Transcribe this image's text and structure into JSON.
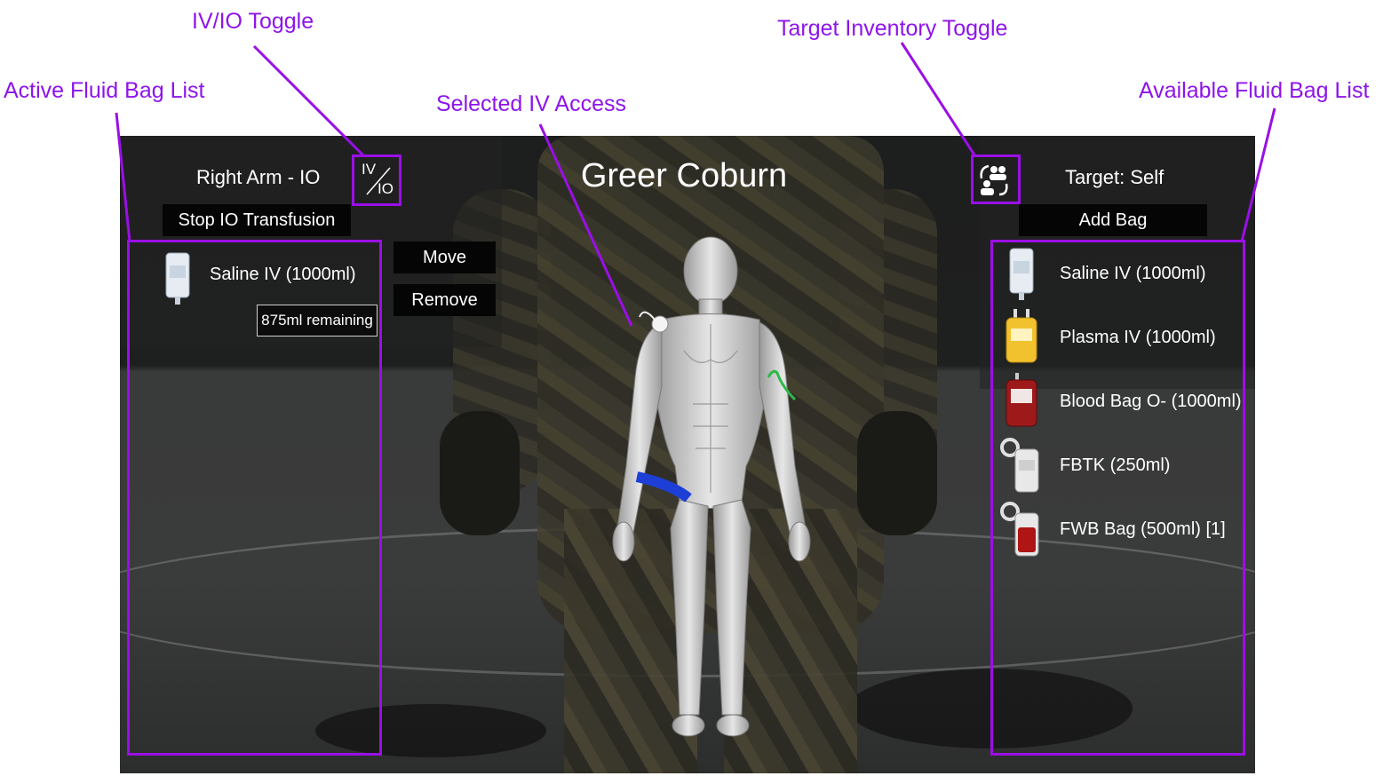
{
  "game": {
    "patient_name": "Greer Coburn",
    "left_panel": {
      "access_site": "Right Arm - IO",
      "stop_button": "Stop IO Transfusion",
      "toggle_top": "IV",
      "toggle_bottom": "IO",
      "active_bags": [
        {
          "label": "Saline IV (1000ml)",
          "remaining": "875ml remaining",
          "icon": "saline-bag-icon"
        }
      ],
      "move_button": "Move",
      "remove_button": "Remove"
    },
    "right_panel": {
      "target": "Target: Self",
      "add_bag_button": "Add Bag",
      "available_bags": [
        {
          "label": "Saline IV (1000ml)",
          "icon": "saline-bag-icon",
          "color": "#dfe6ee"
        },
        {
          "label": "Plasma IV (1000ml)",
          "icon": "plasma-bag-icon",
          "color": "#f2c12e"
        },
        {
          "label": "Blood Bag O- (1000ml)",
          "icon": "blood-bag-icon",
          "color": "#9e1a1a"
        },
        {
          "label": "FBTK (250ml)",
          "icon": "fbtk-icon",
          "color": "#e8e8e8"
        },
        {
          "label": "FWB Bag (500ml) [1]",
          "icon": "fwb-bag-icon",
          "color": "#b01515"
        }
      ]
    }
  },
  "annotations": {
    "iv_io_toggle": "IV/IO Toggle",
    "target_inventory_toggle": "Target Inventory Toggle",
    "active_fluid_bag_list": "Active Fluid Bag List",
    "selected_iv_access": "Selected IV Access",
    "available_fluid_bag_list": "Available Fluid Bag List"
  },
  "colors": {
    "annotation": "#9a0fe6",
    "button_bg": "#050505",
    "tourniquet": "#1e3fd6",
    "iv_line": "#2fb84a"
  }
}
